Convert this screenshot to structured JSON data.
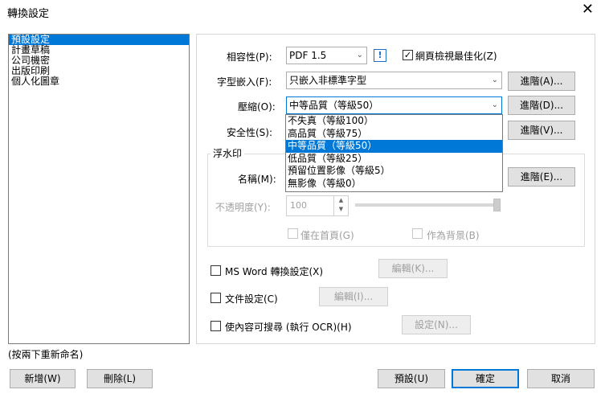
{
  "window": {
    "title": "轉換設定",
    "close_glyph": "✕"
  },
  "presets": {
    "items": [
      "預設設定",
      "計畫草稿",
      "公司機密",
      "出版印刷",
      "個人化圖章"
    ],
    "selected_index": 0
  },
  "rename_hint": "(按兩下重新命名)",
  "buttons": {
    "add": "新增(W)",
    "delete": "刪除(L)",
    "default": "預設(U)",
    "ok": "確定",
    "cancel": "取消"
  },
  "compat": {
    "label": "相容性(P):",
    "value": "PDF 1.5",
    "info": "!"
  },
  "web_optimize": {
    "label": "網頁檢視最佳化(Z)",
    "checked": true
  },
  "font_embed": {
    "label": "字型嵌入(F):",
    "value": "只嵌入非標準字型",
    "advanced": "進階(A)..."
  },
  "compression": {
    "label": "壓縮(O):",
    "value": "中等品質（等級50）",
    "advanced": "進階(D)...",
    "options": [
      "不失真（等級100）",
      "高品質（等級75）",
      "中等品質（等級50）",
      "低品質（等級25）",
      "預留位置影像（等級5）",
      "無影像（等級0）"
    ],
    "selected_index": 2
  },
  "security": {
    "label": "安全性(S):",
    "advanced": "進階(V)..."
  },
  "watermark": {
    "group_title": "浮水印",
    "name_label": "名稱(M):",
    "advanced": "進階(E)...",
    "opacity_label": "不透明度(Y):",
    "opacity_value": "100",
    "first_page_only": "僅在首頁(G)",
    "as_background": "作為背景(B)"
  },
  "ms_word": {
    "label": "MS Word 轉換設定(X)",
    "edit": "編輯(K)..."
  },
  "doc_settings": {
    "label": "文件設定(C)",
    "edit": "編輯(I)..."
  },
  "ocr": {
    "label": "使內容可搜尋 (執行 OCR)(H)",
    "settings": "設定(N)..."
  },
  "icons": {
    "dropdown": "chevron-down-icon",
    "check": "check-icon",
    "info": "info-icon"
  },
  "colors": {
    "accent": "#0078d7",
    "info_blue": "#1a6fc9"
  }
}
